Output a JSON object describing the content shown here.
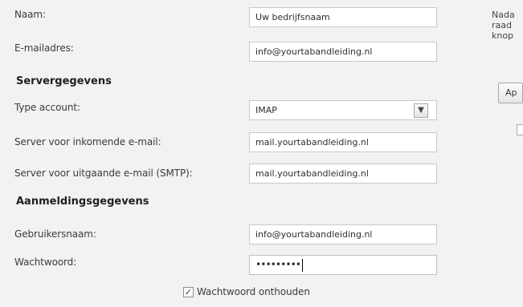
{
  "fields": {
    "name": {
      "label": "Naam:",
      "value": "Uw bedrijfsnaam"
    },
    "email": {
      "label": "E-mailadres:",
      "value": "info@yourtabandleiding.nl"
    }
  },
  "server": {
    "heading": "Servergegevens",
    "account_type": {
      "label": "Type account:",
      "value": "IMAP"
    },
    "incoming": {
      "label": "Server voor inkomende e-mail:",
      "value": "mail.yourtabandleiding.nl"
    },
    "outgoing": {
      "label": "Server voor uitgaande e-mail (SMTP):",
      "value": "mail.yourtabandleiding.nl"
    }
  },
  "login": {
    "heading": "Aanmeldingsgegevens",
    "username": {
      "label": "Gebruikersnaam:",
      "value": "info@yourtabandleiding.nl"
    },
    "password": {
      "label": "Wachtwoord:",
      "value": "•••••••••"
    },
    "remember": {
      "label": "Wachtwoord onthouden",
      "checked": true
    }
  },
  "side": {
    "line1": "Nada",
    "line2": "raad",
    "line3": "knop",
    "button": "Ap"
  }
}
